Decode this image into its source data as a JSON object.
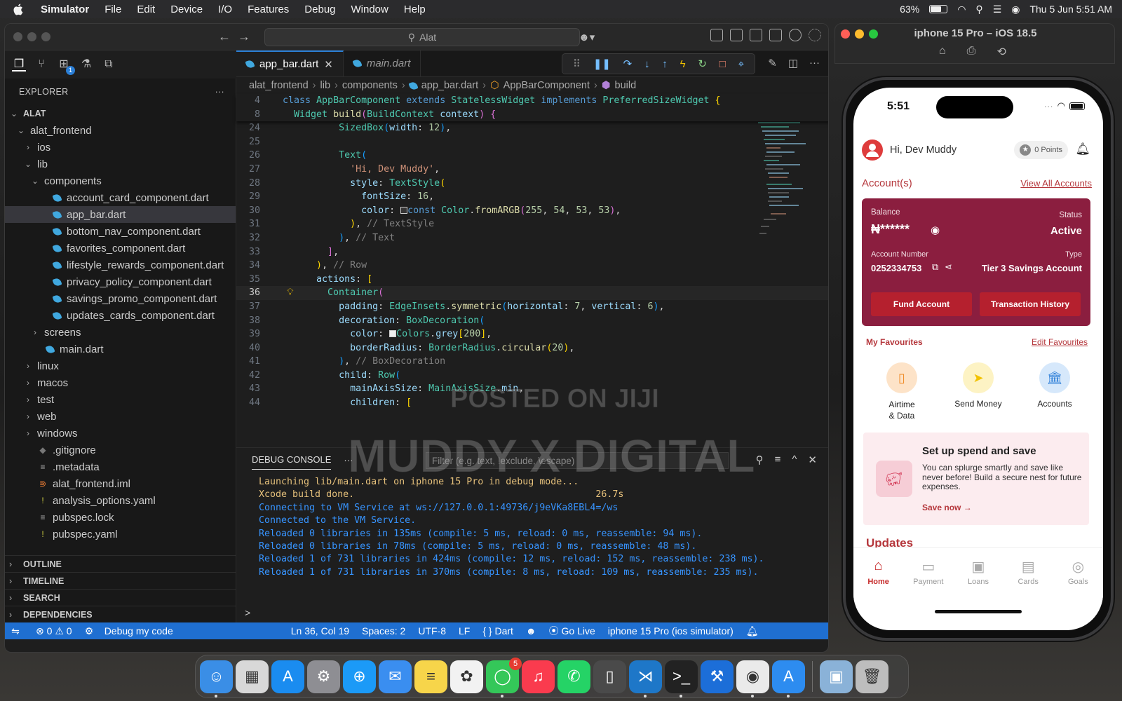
{
  "menubar": {
    "app": "Simulator",
    "items": [
      "File",
      "Edit",
      "Device",
      "I/O",
      "Features",
      "Debug",
      "Window",
      "Help"
    ],
    "battery": "63%",
    "datetime": "Thu 5 Jun  5:51 AM"
  },
  "vscode": {
    "search": "Alat",
    "activity_badge": "1",
    "explorer_title": "EXPLORER",
    "explorer_more": "···",
    "tree": [
      {
        "label": "ALAT",
        "depth": 0,
        "chev": "v",
        "icon": "",
        "bold": true
      },
      {
        "label": "alat_frontend",
        "depth": 1,
        "chev": "v",
        "icon": ""
      },
      {
        "label": "ios",
        "depth": 2,
        "chev": ">",
        "icon": ""
      },
      {
        "label": "lib",
        "depth": 2,
        "chev": "v",
        "icon": ""
      },
      {
        "label": "components",
        "depth": 3,
        "chev": "v",
        "icon": ""
      },
      {
        "label": "account_card_component.dart",
        "depth": 4,
        "chev": "",
        "icon": "dart"
      },
      {
        "label": "app_bar.dart",
        "depth": 4,
        "chev": "",
        "icon": "dart",
        "selected": true
      },
      {
        "label": "bottom_nav_component.dart",
        "depth": 4,
        "chev": "",
        "icon": "dart"
      },
      {
        "label": "favorites_component.dart",
        "depth": 4,
        "chev": "",
        "icon": "dart"
      },
      {
        "label": "lifestyle_rewards_component.dart",
        "depth": 4,
        "chev": "",
        "icon": "dart"
      },
      {
        "label": "privacy_policy_component.dart",
        "depth": 4,
        "chev": "",
        "icon": "dart"
      },
      {
        "label": "savings_promo_component.dart",
        "depth": 4,
        "chev": "",
        "icon": "dart"
      },
      {
        "label": "updates_cards_component.dart",
        "depth": 4,
        "chev": "",
        "icon": "dart"
      },
      {
        "label": "screens",
        "depth": 3,
        "chev": ">",
        "icon": ""
      },
      {
        "label": "main.dart",
        "depth": 3,
        "chev": "",
        "icon": "dart"
      },
      {
        "label": "linux",
        "depth": 2,
        "chev": ">",
        "icon": ""
      },
      {
        "label": "macos",
        "depth": 2,
        "chev": ">",
        "icon": ""
      },
      {
        "label": "test",
        "depth": 2,
        "chev": ">",
        "icon": ""
      },
      {
        "label": "web",
        "depth": 2,
        "chev": ">",
        "icon": ""
      },
      {
        "label": "windows",
        "depth": 2,
        "chev": ">",
        "icon": ""
      },
      {
        "label": ".gitignore",
        "depth": 2,
        "chev": "",
        "icon": "git"
      },
      {
        "label": ".metadata",
        "depth": 2,
        "chev": "",
        "icon": "lines"
      },
      {
        "label": "alat_frontend.iml",
        "depth": 2,
        "chev": "",
        "icon": "rss"
      },
      {
        "label": "analysis_options.yaml",
        "depth": 2,
        "chev": "",
        "icon": "bang"
      },
      {
        "label": "pubspec.lock",
        "depth": 2,
        "chev": "",
        "icon": "lines"
      },
      {
        "label": "pubspec.yaml",
        "depth": 2,
        "chev": "",
        "icon": "bang"
      }
    ],
    "sections": [
      "OUTLINE",
      "TIMELINE",
      "SEARCH",
      "DEPENDENCIES"
    ],
    "tabs": [
      {
        "label": "app_bar.dart",
        "active": true
      },
      {
        "label": "main.dart",
        "active": false
      }
    ],
    "breadcrumb": [
      "alat_frontend",
      "lib",
      "components",
      "app_bar.dart",
      "AppBarComponent",
      "build"
    ],
    "sticky": [
      {
        "n": "4",
        "html": "<span class=\"k\">class</span> <span class=\"ty\">AppBarComponent</span> <span class=\"k\">extends</span> <span class=\"ty\">StatelessWidget</span> <span class=\"k\">implements</span> <span class=\"ty\">PreferredSizeWidget</span> <span class=\"br1\">{</span>"
      },
      {
        "n": "8",
        "html": "  <span class=\"ty\">Widget</span> <span class=\"f\">build</span><span class=\"br2\">(</span><span class=\"ty\">BuildContext</span> <span class=\"p\">context</span><span class=\"br2\">)</span> <span class=\"br2\">{</span>"
      }
    ],
    "code": [
      {
        "n": "24",
        "html": "          <span class=\"ty\">SizedBox</span><span class=\"br3\">(</span><span class=\"p\">width</span>: <span class=\"n\">12</span><span class=\"br3\">)</span>,"
      },
      {
        "n": "25",
        "html": ""
      },
      {
        "n": "26",
        "html": "          <span class=\"ty\">Text</span><span class=\"br3\">(</span>"
      },
      {
        "n": "27",
        "html": "            <span class=\"s\">'Hi, Dev Muddy'</span>,"
      },
      {
        "n": "28",
        "html": "            <span class=\"p\">style</span>: <span class=\"ty\">TextStyle</span><span class=\"br1\">(</span>"
      },
      {
        "n": "29",
        "html": "              <span class=\"p\">fontSize</span>: <span class=\"n\">16</span>,"
      },
      {
        "n": "30",
        "html": "              <span class=\"p\">color</span>: <span style=\"display:inline-block;width:10px;height:10px;border:1px solid #ccc;background:#363535;vertical-align:-1px\"></span><span class=\"k\">const</span> <span class=\"ty\">Color</span>.<span class=\"f\">fromARGB</span><span class=\"br2\">(</span><span class=\"n\">255</span>, <span class=\"n\">54</span>, <span class=\"n\">53</span>, <span class=\"n\">53</span><span class=\"br2\">)</span>,"
      },
      {
        "n": "31",
        "html": "            <span class=\"br1\">)</span>, <span class=\"c2\">// TextStyle</span>"
      },
      {
        "n": "32",
        "html": "          <span class=\"br3\">)</span>, <span class=\"c2\">// Text</span>"
      },
      {
        "n": "33",
        "html": "        <span class=\"br2\">]</span>,"
      },
      {
        "n": "34",
        "html": "      <span class=\"br1\">)</span>, <span class=\"c2\">// Row</span>"
      },
      {
        "n": "35",
        "html": "      <span class=\"p\">actions</span>: <span class=\"br1\">[</span>"
      },
      {
        "n": "36",
        "html": "        <span class=\"ty\">Container</span><span class=\"br2\">(</span>",
        "cur": true
      },
      {
        "n": "37",
        "html": "          <span class=\"p\">padding</span>: <span class=\"ty\">EdgeInsets</span>.<span class=\"f\">symmetric</span><span class=\"br3\">(</span><span class=\"p\">horizontal</span>: <span class=\"n\">7</span>, <span class=\"p\">vertical</span>: <span class=\"n\">6</span><span class=\"br3\">)</span>,"
      },
      {
        "n": "38",
        "html": "          <span class=\"p\">decoration</span>: <span class=\"ty\">BoxDecoration</span><span class=\"br3\">(</span>"
      },
      {
        "n": "39",
        "html": "            <span class=\"p\">color</span>: <span style=\"display:inline-block;width:10px;height:10px;border:1px solid #ccc;background:#eeeeee;vertical-align:-1px\"></span><span class=\"ty\">Colors</span>.<span class=\"p\">grey</span><span class=\"br1\">[</span><span class=\"n\">200</span><span class=\"br1\">]</span>,"
      },
      {
        "n": "40",
        "html": "            <span class=\"p\">borderRadius</span>: <span class=\"ty\">BorderRadius</span>.<span class=\"f\">circular</span><span class=\"br1\">(</span><span class=\"n\">20</span><span class=\"br1\">)</span>,"
      },
      {
        "n": "41",
        "html": "          <span class=\"br3\">)</span>, <span class=\"c2\">// BoxDecoration</span>"
      },
      {
        "n": "42",
        "html": "          <span class=\"p\">child</span>: <span class=\"ty\">Row</span><span class=\"br3\">(</span>"
      },
      {
        "n": "43",
        "html": "            <span class=\"p\">mainAxisSize</span>: <span class=\"ty\">MainAxisSize</span>.<span class=\"p\">min</span>,"
      },
      {
        "n": "44",
        "html": "            <span class=\"p\">children</span>: <span class=\"br1\">[</span>"
      }
    ],
    "panel": {
      "title": "DEBUG CONSOLE",
      "more": "···",
      "filter_placeholder": "Filter (e.g. text, !exclude, \\escape)",
      "lines": [
        {
          "text": "Launching lib/main.dart on iphone 15 Pro in debug mode...",
          "cls": "cy"
        },
        {
          "text": "Xcode build done.                                           26.7s",
          "cls": "cy"
        },
        {
          "text": "Connecting to VM Service at ws://127.0.0.1:49736/j9eVKa8EBL4=/ws",
          "cls": "cb"
        },
        {
          "text": "Connected to the VM Service.",
          "cls": "cb"
        },
        {
          "text": "Reloaded 0 libraries in 135ms (compile: 5 ms, reload: 0 ms, reassemble: 94 ms).",
          "cls": "cb"
        },
        {
          "text": "Reloaded 0 libraries in 78ms (compile: 5 ms, reload: 0 ms, reassemble: 48 ms).",
          "cls": "cb"
        },
        {
          "text": "Reloaded 1 of 731 libraries in 424ms (compile: 12 ms, reload: 152 ms, reassemble: 238 ms).",
          "cls": "cb"
        },
        {
          "text": "Reloaded 1 of 731 libraries in 370ms (compile: 8 ms, reload: 109 ms, reassemble: 235 ms).",
          "cls": "cb"
        }
      ],
      "prompt": ">"
    },
    "status": {
      "errors": "0",
      "warnings": "0",
      "debug": "Debug my code",
      "position": "Ln 36, Col 19",
      "spaces": "Spaces: 2",
      "encoding": "UTF-8",
      "eol": "LF",
      "language": "Dart",
      "golive": "Go Live",
      "device": "iphone 15 Pro (ios simulator)"
    }
  },
  "watermarks": [
    "POSTED ON JIJI",
    "MUDDY X DIGITAL"
  ],
  "simulator": {
    "title": "iphone 15 Pro – iOS 18.5",
    "time": "5:51",
    "greeting": "Hi, Dev Muddy",
    "points": "0 Points",
    "accounts_title": "Account(s)",
    "view_all": "View All Accounts",
    "card": {
      "balance_label": "Balance",
      "balance": "₦******",
      "status_label": "Status",
      "status": "Active",
      "acct_label": "Account Number",
      "acct": "0252334753",
      "type_label": "Type",
      "type": "Tier 3 Savings Account",
      "fund": "Fund Account",
      "history": "Transaction History"
    },
    "fav_title": "My Favourites",
    "fav_edit": "Edit Favourites",
    "favourites": [
      {
        "label": "Airtime\n& Data",
        "icon": "phone-icon",
        "color": "#fde3c8",
        "fg": "#f08a24"
      },
      {
        "label": "Send Money",
        "icon": "send-icon",
        "color": "#fdf3c4",
        "fg": "#f2c200"
      },
      {
        "label": "Accounts",
        "icon": "bank-icon",
        "color": "#d6e8fb",
        "fg": "#2e7fd8"
      }
    ],
    "promo": {
      "title": "Set up spend and save",
      "desc": "You can splurge smartly and save like never before! Build a secure nest for future expenses.",
      "cta": "Save now"
    },
    "updates": "Updates",
    "nav": [
      {
        "label": "Home",
        "icon": "home-icon",
        "active": true
      },
      {
        "label": "Payment",
        "icon": "payment-icon"
      },
      {
        "label": "Loans",
        "icon": "loans-icon"
      },
      {
        "label": "Cards",
        "icon": "cards-icon"
      },
      {
        "label": "Goals",
        "icon": "goals-icon"
      }
    ]
  },
  "dock": {
    "apps": [
      {
        "name": "finder",
        "color": "#3a8ee6",
        "glyph": "☺"
      },
      {
        "name": "launchpad",
        "color": "#d8d8d8",
        "glyph": "▦"
      },
      {
        "name": "app-store",
        "color": "#1a8cf0",
        "glyph": "A"
      },
      {
        "name": "system-settings",
        "color": "#8e8e93",
        "glyph": "⚙"
      },
      {
        "name": "safari",
        "color": "#1b9af7",
        "glyph": "⊕"
      },
      {
        "name": "mail",
        "color": "#3a8ef0",
        "glyph": "✉"
      },
      {
        "name": "notes",
        "color": "#f7d54a",
        "glyph": "≡"
      },
      {
        "name": "photos",
        "color": "#f2f2f2",
        "glyph": "✿"
      },
      {
        "name": "messages",
        "color": "#34c759",
        "glyph": "◯",
        "badge": "5"
      },
      {
        "name": "music",
        "color": "#fa3b4e",
        "glyph": "♫"
      },
      {
        "name": "whatsapp",
        "color": "#25d366",
        "glyph": "✆"
      },
      {
        "name": "iphone-mirroring",
        "color": "#4a4a4a",
        "glyph": "▯"
      },
      {
        "name": "vscode",
        "color": "#1e77c8",
        "glyph": "⋊"
      },
      {
        "name": "terminal",
        "color": "#222",
        "glyph": ">_"
      },
      {
        "name": "xcode",
        "color": "#1c6ed8",
        "glyph": "⚒"
      },
      {
        "name": "chrome",
        "color": "#eaeaea",
        "glyph": "◉"
      },
      {
        "name": "simulator",
        "color": "#2d8cf0",
        "glyph": "A"
      },
      {
        "name": "preview",
        "color": "#8ab2d8",
        "glyph": "▣"
      },
      {
        "name": "trash",
        "color": "#bdbdbd",
        "glyph": "🗑"
      }
    ]
  },
  "colors": {
    "vscode_status": "#1f6fd1",
    "card": "#8b1e3f",
    "accent_red": "#b5373c"
  }
}
